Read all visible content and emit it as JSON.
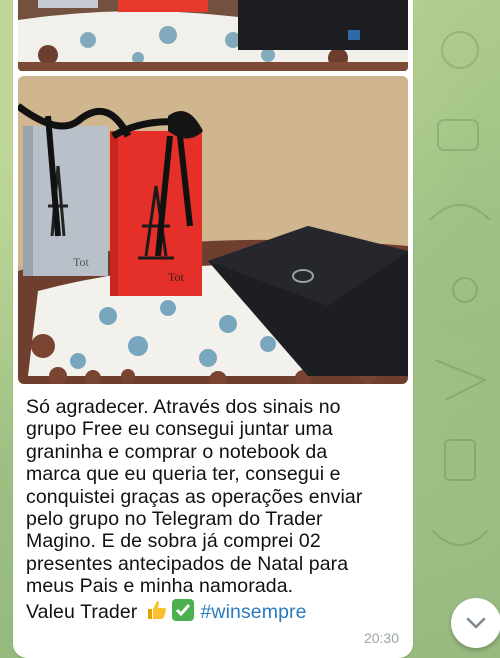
{
  "message": {
    "lines": [
      "Só agradecer. Através dos sinais no",
      "grupo Free eu consegui juntar uma",
      "graninha e comprar o notebook da",
      "marca que eu queria ter, consegui e",
      "conquistei graças as operações enviar",
      "pelo grupo no Telegram do Trader",
      "Magino. E de sobra já comprei 02",
      "presentes antecipados de Natal para",
      "meus Pais e minha namorada."
    ],
    "last_line_text": "Valeu Trader ",
    "emojis": [
      "thumbs-up",
      "check-mark"
    ],
    "hashtag": "#winsempre",
    "time": "20:30"
  },
  "colors": {
    "chat_background": "#a9c98f",
    "bubble": "#ffffff",
    "hashtag": "#2b7bc1",
    "timestamp": "#9aa3a8"
  },
  "icons": [
    "chevron-down-icon"
  ]
}
